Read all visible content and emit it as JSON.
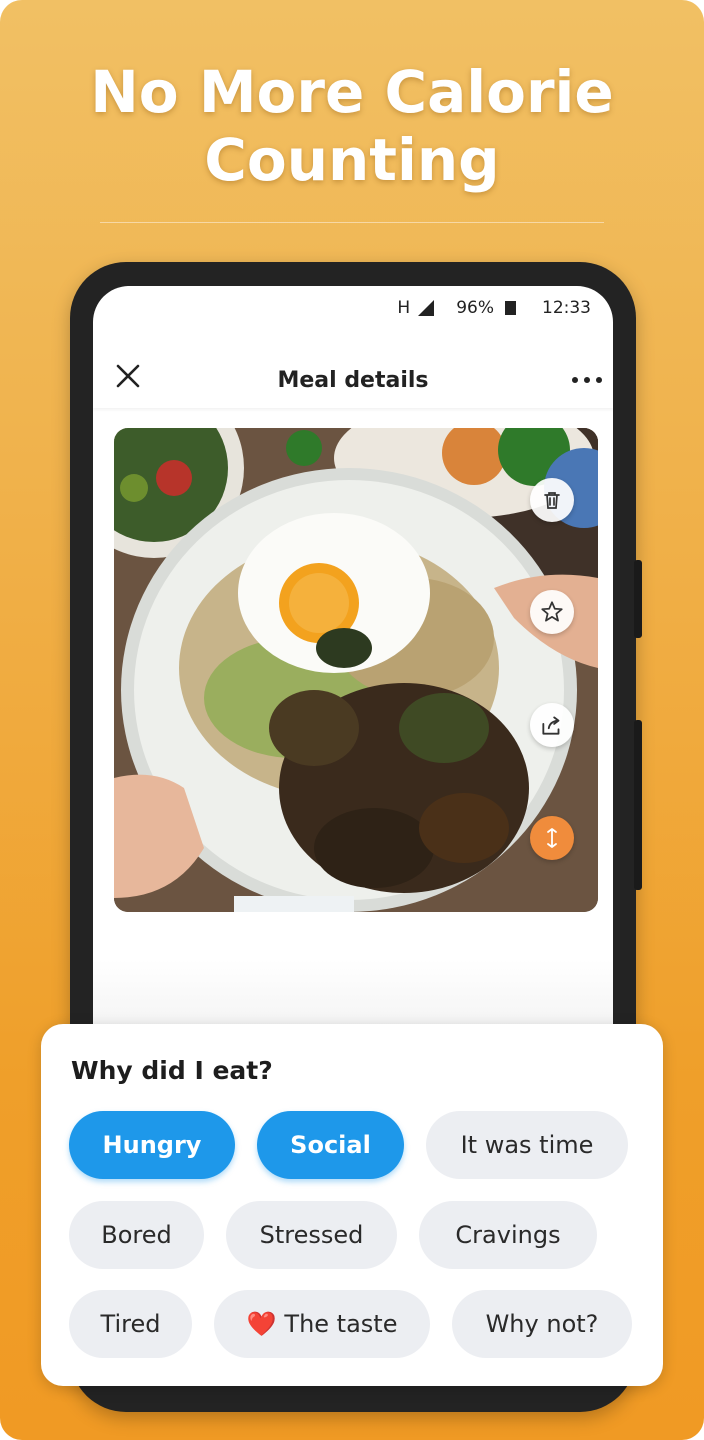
{
  "headline": "No More Calorie\nCounting",
  "status_bar": {
    "network": "H",
    "battery": "96%",
    "time": "12:33"
  },
  "nav": {
    "title": "Meal details",
    "close_icon": "close-icon",
    "more_icon": "more-icon"
  },
  "photo_actions": [
    {
      "icon": "trash-icon"
    },
    {
      "icon": "star-icon"
    },
    {
      "icon": "share-icon"
    },
    {
      "icon": "resize-icon",
      "color": "#f08c3c"
    }
  ],
  "why_eat": {
    "title": "Why did I eat?",
    "chips": [
      {
        "label": "Hungry",
        "selected": true
      },
      {
        "label": "Social",
        "selected": true
      },
      {
        "label": "It was time",
        "selected": false
      },
      {
        "label": "Bored",
        "selected": false
      },
      {
        "label": "Stressed",
        "selected": false
      },
      {
        "label": "Cravings",
        "selected": false
      },
      {
        "label": "Tired",
        "selected": false
      },
      {
        "label": "The taste",
        "emoji": "❤️",
        "selected": false
      },
      {
        "label": "Why not?",
        "selected": false
      }
    ]
  },
  "colors": {
    "accent": "#1e98ea",
    "background": "#f0b14a",
    "resize_button": "#f08c3c"
  }
}
